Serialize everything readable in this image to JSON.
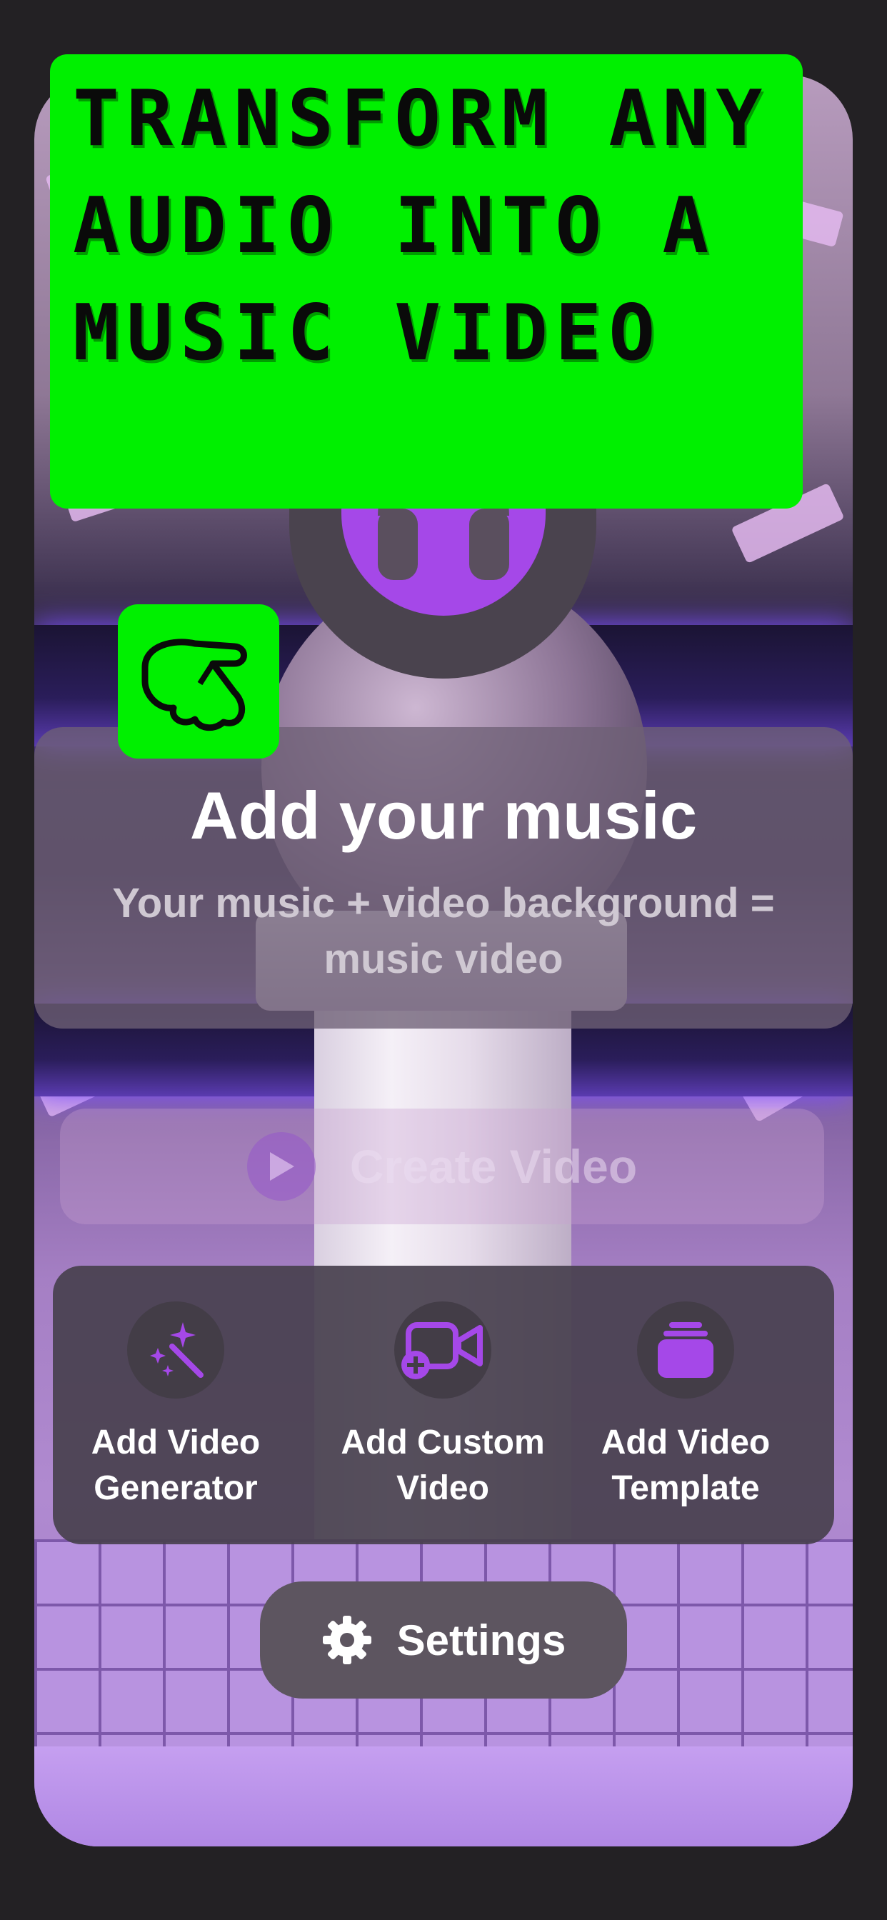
{
  "banner": {
    "title": "Transform any audio into a music video"
  },
  "music_card": {
    "title": "Add your music",
    "subtitle": "Your music + video background = music video"
  },
  "create_video": {
    "label": "Create Video"
  },
  "actions": [
    {
      "label_line1": "Add Video",
      "label_line2": "Generator",
      "icon": "magic-wand-icon"
    },
    {
      "label_line1": "Add Custom",
      "label_line2": "Video",
      "icon": "video-camera-plus-icon"
    },
    {
      "label_line1": "Add Video",
      "label_line2": "Template",
      "icon": "stacked-layers-icon"
    }
  ],
  "settings": {
    "label": "Settings",
    "icon": "gear-icon"
  },
  "colors": {
    "accent": "#a548e8",
    "banner_green": "#00f000",
    "background": "#232124"
  }
}
